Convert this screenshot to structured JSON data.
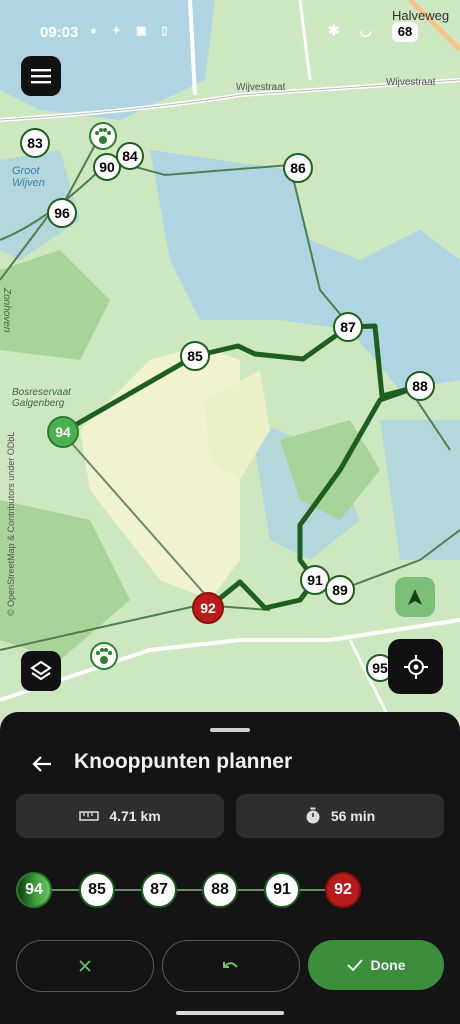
{
  "status_bar": {
    "time": "09:03",
    "battery": "68"
  },
  "map": {
    "place_labels": [
      "Halveweg",
      "Wijvestraat",
      "Wijvestraat",
      "Groot Wijven",
      "Zonhoven",
      "Bosreservaat Galgenberg"
    ],
    "attribution": "© OpenStreetMap & Contributors under ODbL",
    "nodes": [
      "83",
      "90",
      "84",
      "86",
      "96",
      "87",
      "85",
      "88",
      "94",
      "91",
      "89",
      "92",
      "95"
    ],
    "route_color": "#1e5e1e"
  },
  "planner": {
    "title": "Knooppunten planner",
    "distance": "4.71 km",
    "duration": "56 min",
    "route_nodes": [
      "94",
      "85",
      "87",
      "88",
      "91",
      "92"
    ],
    "done_label": "Done"
  },
  "colors": {
    "accent": "#3c8e3c",
    "end_node": "#b71c1c",
    "sheet_bg": "#141414"
  }
}
